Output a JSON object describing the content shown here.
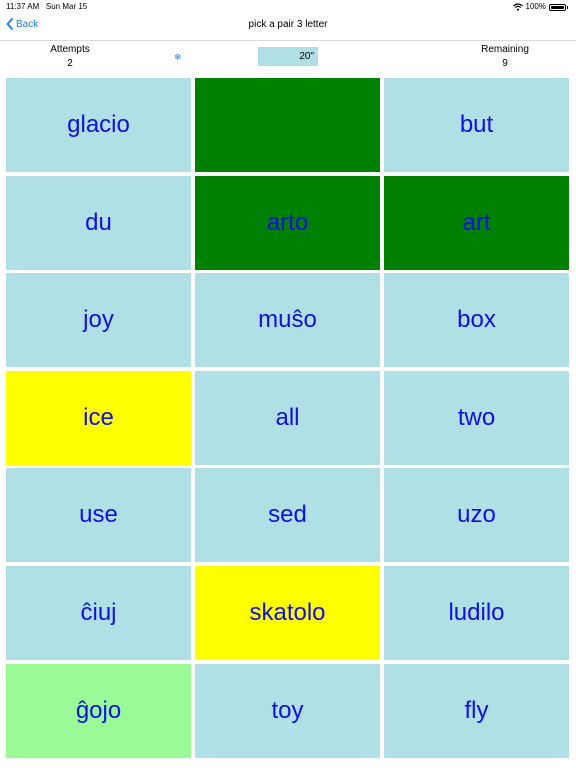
{
  "status": {
    "time": "11:37 AM",
    "date": "Sun Mar 15",
    "battery": "100%"
  },
  "nav": {
    "back_label": "Back",
    "title": "pick a pair 3 letter"
  },
  "stats": {
    "attempts_label": "Attempts",
    "attempts_value": "2",
    "remaining_label": "Remaining",
    "remaining_value": "9",
    "timer": "20\""
  },
  "colors": {
    "accent": "#1a7cf5",
    "tile_default": "#b0dfe6",
    "tile_matched": "#008000",
    "tile_selected": "#ffff00",
    "tile_hint": "#98fb98",
    "tile_text": "#1010e0"
  },
  "tiles": [
    {
      "label": "glacio",
      "state": "default"
    },
    {
      "label": "",
      "state": "matched"
    },
    {
      "label": "but",
      "state": "default"
    },
    {
      "label": "du",
      "state": "default"
    },
    {
      "label": "arto",
      "state": "matched"
    },
    {
      "label": "art",
      "state": "matched"
    },
    {
      "label": "joy",
      "state": "default"
    },
    {
      "label": "muŝo",
      "state": "default"
    },
    {
      "label": "box",
      "state": "default"
    },
    {
      "label": "ice",
      "state": "selected"
    },
    {
      "label": "all",
      "state": "default"
    },
    {
      "label": "two",
      "state": "default"
    },
    {
      "label": "use",
      "state": "default"
    },
    {
      "label": "sed",
      "state": "default"
    },
    {
      "label": "uzo",
      "state": "default"
    },
    {
      "label": "ĉiuj",
      "state": "default"
    },
    {
      "label": "skatolo",
      "state": "selected"
    },
    {
      "label": "ludilo",
      "state": "default"
    },
    {
      "label": "ĝojo",
      "state": "hint"
    },
    {
      "label": "toy",
      "state": "default"
    },
    {
      "label": "fly",
      "state": "default"
    }
  ]
}
